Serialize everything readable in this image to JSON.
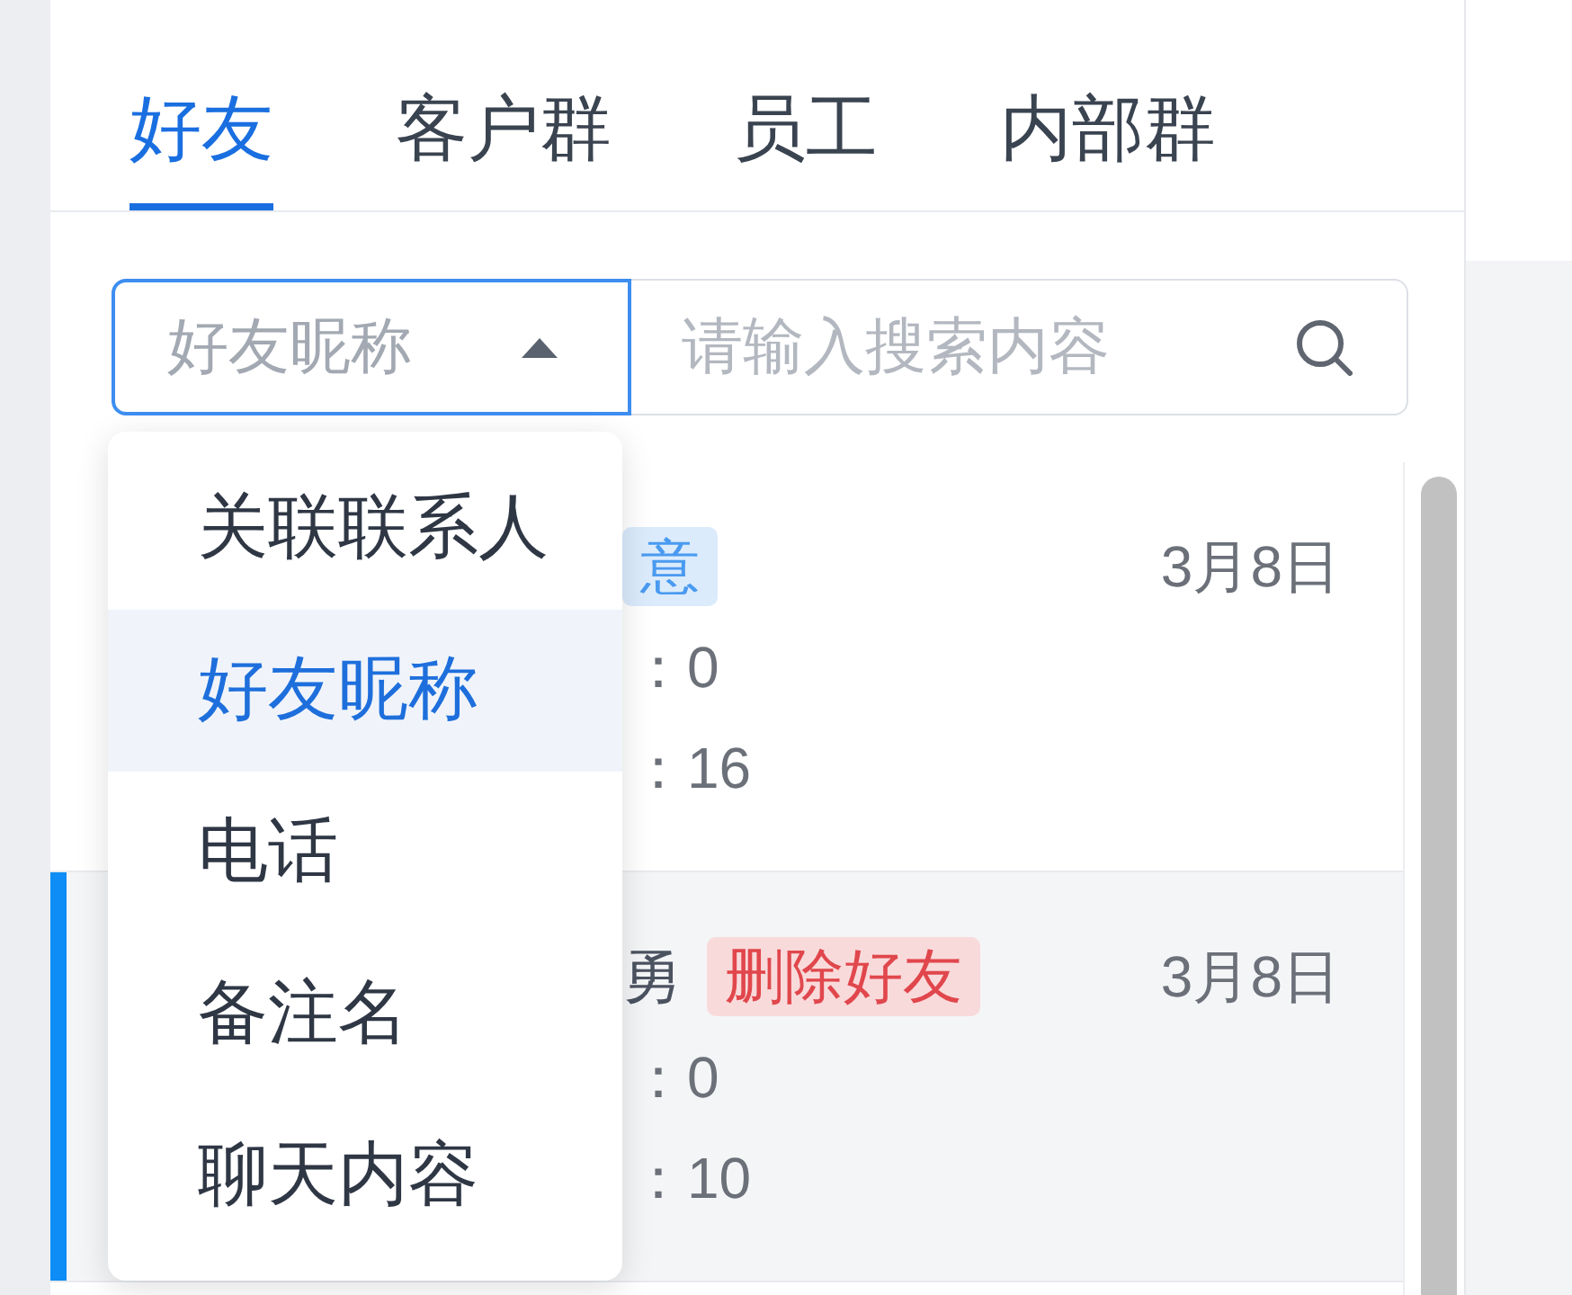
{
  "tabs": [
    {
      "label": "好友",
      "selected": true
    },
    {
      "label": "客户群",
      "selected": false
    },
    {
      "label": "员工",
      "selected": false
    },
    {
      "label": "内部群",
      "selected": false
    }
  ],
  "search": {
    "filter": {
      "value": "好友昵称",
      "expanded": true
    },
    "placeholder": "请输入搜索内容"
  },
  "filter_menu": {
    "items": [
      {
        "label": "关联联系人",
        "selected": false
      },
      {
        "label": "好友昵称",
        "selected": true
      },
      {
        "label": "电话",
        "selected": false
      },
      {
        "label": "备注名",
        "selected": false
      },
      {
        "label": "聊天内容",
        "selected": false
      }
    ]
  },
  "list": {
    "items": [
      {
        "tag": {
          "text": "意",
          "color": "#4a9af0"
        },
        "date": "3月8日",
        "lines": [
          "：0",
          "：16"
        ],
        "selected": false
      },
      {
        "name": "勇",
        "tag": {
          "text": "删除好友",
          "color": "#e0474c"
        },
        "date": "3月8日",
        "lines": [
          "：0",
          "：10"
        ],
        "selected": true
      }
    ]
  }
}
